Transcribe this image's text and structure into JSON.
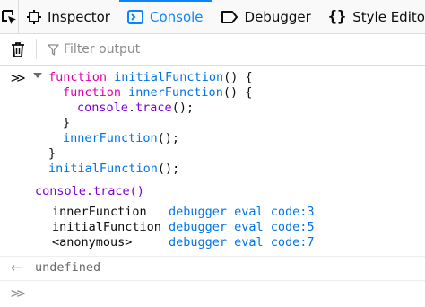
{
  "toolbar": {
    "tabs": [
      {
        "label": "Inspector",
        "icon": "inspector-icon"
      },
      {
        "label": "Console",
        "icon": "console-icon",
        "selected": true
      },
      {
        "label": "Debugger",
        "icon": "debugger-icon"
      },
      {
        "label": "Style Editor",
        "icon": "style-editor-icon"
      }
    ],
    "accent_color": "#0a84ff"
  },
  "filter": {
    "placeholder": "Filter output"
  },
  "input_block": {
    "lines": [
      {
        "kw": "function ",
        "name": "initialFunction",
        "rest": "() {"
      },
      {
        "kw": "function ",
        "name": "innerFunction",
        "rest": "() {"
      },
      {
        "obj": "console",
        "dot": ".",
        "method": "trace",
        "rest": "();"
      },
      {
        "text": "}"
      },
      {
        "name": "innerFunction",
        "rest": "();"
      },
      {
        "text": "}"
      },
      {
        "name": "initialFunction",
        "rest": "();"
      }
    ]
  },
  "trace": {
    "header": "console.trace()",
    "frames": [
      {
        "fn": "innerFunction",
        "location": "debugger eval code:3"
      },
      {
        "fn": "initialFunction",
        "location": "debugger eval code:5"
      },
      {
        "fn": "<anonymous>",
        "location": "debugger eval code:7"
      }
    ]
  },
  "result": {
    "value": "undefined"
  },
  "colors": {
    "keyword": "#dd00a9",
    "function_name": "#0074e8",
    "console_call": "#8000d7"
  }
}
